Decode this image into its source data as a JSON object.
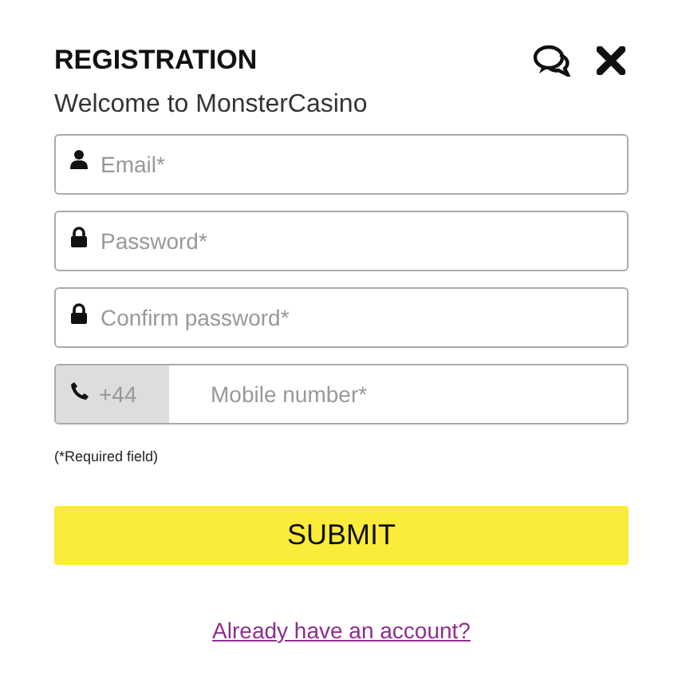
{
  "header": {
    "title": "REGISTRATION",
    "subtitle": "Welcome to MonsterCasino"
  },
  "fields": [
    {
      "kind": "user",
      "placeholder": "Email*"
    },
    {
      "kind": "lock",
      "placeholder": "Password*"
    },
    {
      "kind": "lock",
      "placeholder": "Confirm password*"
    },
    {
      "kind": "phone",
      "prefix": "+44",
      "placeholder": "Mobile number*"
    }
  ],
  "note": "(*Required field)",
  "submit": "SUBMIT",
  "login_link": "Already have an account?"
}
